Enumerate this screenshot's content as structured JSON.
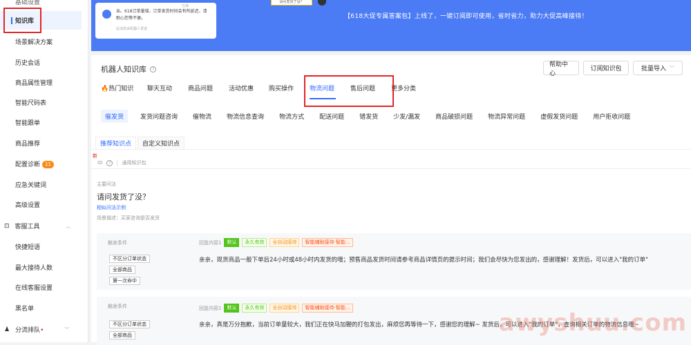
{
  "sidebar": {
    "top_cut": "基础设置",
    "items": [
      {
        "label": "知识库"
      },
      {
        "label": "场景解决方案"
      },
      {
        "label": "历史会话"
      },
      {
        "label": "商品属性管理"
      },
      {
        "label": "智能尺码表"
      },
      {
        "label": "智能跟单"
      },
      {
        "label": "商品推荐"
      },
      {
        "label": "配置诊断",
        "badge": "11"
      },
      {
        "label": "应急关键词"
      },
      {
        "label": "高级设置"
      }
    ],
    "group1": "客服工具",
    "group1_items": [
      {
        "label": "快捷短语"
      },
      {
        "label": "最大接待人数"
      },
      {
        "label": "在线客服设置"
      },
      {
        "label": "黑名单"
      }
    ],
    "group2": "分流排队",
    "group2_mark": "•"
  },
  "banner": {
    "card_msg": "亲。618订单量增，订单发货时间会有所延迟，请耐心您等不便。",
    "card_sub": "此消息由机器人发送",
    "card_time": "已读",
    "bubble": "请问发货了没？",
    "text": "【618大促专属答案包】上线了，一键订阅即可使用，省时省力，助力大促高峰接待！"
  },
  "header": {
    "title": "机器人知识库",
    "buttons": {
      "help": "帮助中心",
      "subscribe": "订阅知识包",
      "import": "批量导入"
    }
  },
  "tabs": [
    "🔥热门知识",
    "聊天互动",
    "商品问题",
    "活动优惠",
    "购买操作",
    "物流问题",
    "售后问题",
    "更多分类"
  ],
  "subtabs": [
    "催发货",
    "发货问题咨询",
    "催物流",
    "物流信息查询",
    "物流方式",
    "配送问题",
    "错发货",
    "少发/漏发",
    "商品破损问题",
    "物流异常问题",
    "虚假发货问题",
    "用户拒收问题"
  ],
  "know_tabs": {
    "recommend": "推荐知识点",
    "custom": "自定义知识点"
  },
  "new_mark": "新",
  "id_row": {
    "id": "ID",
    "pack": "通用知识包"
  },
  "question": {
    "label": "主要问法",
    "text": "请问发货了没？",
    "link": "相似问法示例",
    "scene": "场景描述：买家咨询是否发货"
  },
  "replies": [
    {
      "cond_label": "触发条件",
      "conditions": [
        "不区分订单状态",
        "全部商品",
        "第一次命中"
      ],
      "label": "回复内容1",
      "tags": [
        {
          "text": "默认",
          "style": "g"
        },
        {
          "text": "永久有效",
          "style": "go"
        },
        {
          "text": "全自动接待",
          "style": "o"
        },
        {
          "text": "智能辅助接待·智能…",
          "style": "r"
        }
      ],
      "text": "亲亲，现货商品一般下单后24小时或48小时内发货的哦；预售商品发货时间请参考商品详情页的提示时间；我们会尽快为您发出的，感谢理解！发货后，可以进入\"我的订单\""
    },
    {
      "cond_label": "触发条件",
      "conditions": [
        "不区分订单状态",
        "全部商品"
      ],
      "label": "回复内容2",
      "tags": [
        {
          "text": "默认",
          "style": "g"
        },
        {
          "text": "永久有效",
          "style": "go"
        },
        {
          "text": "全自动接待",
          "style": "o"
        },
        {
          "text": "智能辅助接待·智能…",
          "style": "r"
        }
      ],
      "text": "亲亲，真是万分抱歉，当前订单量较大，我们正在快马加鞭的打包发出，麻烦您再等待一下，感谢您的理解~ 发货后，可以进入\"我的订单\"，查询相关订单的物流信息哦~"
    }
  ],
  "watermark": "awyshuu.com"
}
